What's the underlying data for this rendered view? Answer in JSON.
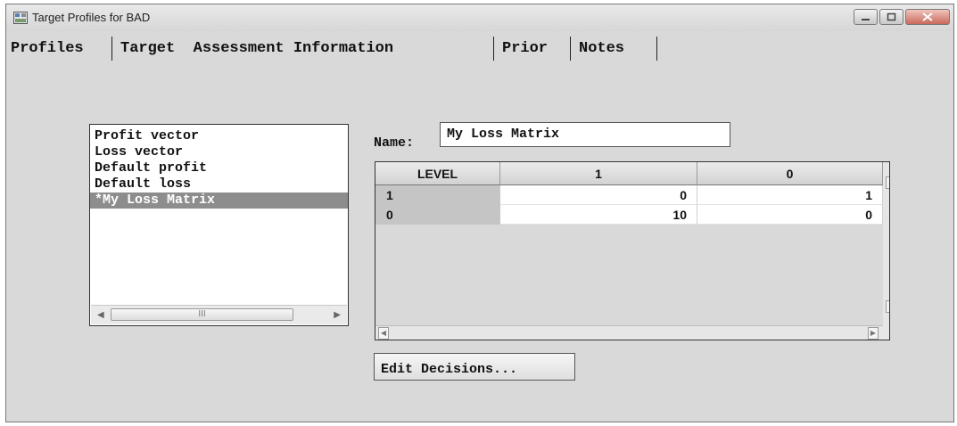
{
  "window": {
    "title": "Target Profiles for BAD",
    "icons": [
      "app-icon",
      "minimize-icon",
      "maximize-icon",
      "close-icon"
    ]
  },
  "tabs": [
    {
      "label": "Profiles"
    },
    {
      "label": "Target  Assessment Information"
    },
    {
      "label": "Prior"
    },
    {
      "label": "Notes"
    }
  ],
  "profiles": {
    "items": [
      "Profit vector",
      "Loss vector",
      "Default profit",
      "Default loss",
      "*My Loss Matrix"
    ],
    "selected_index": 4,
    "scroll_thumb_glyph": "III"
  },
  "name": {
    "label": "Name:",
    "value": "My Loss Matrix"
  },
  "matrix": {
    "columns": [
      "LEVEL",
      "1",
      "0"
    ],
    "rows": [
      {
        "level": "1",
        "values": [
          "0",
          "1"
        ]
      },
      {
        "level": "0",
        "values": [
          "10",
          "0"
        ]
      }
    ]
  },
  "buttons": {
    "edit_decisions": "Edit Decisions..."
  },
  "colors": {
    "selection": "#8d8d8d",
    "window_bg": "#d9d9d9"
  }
}
